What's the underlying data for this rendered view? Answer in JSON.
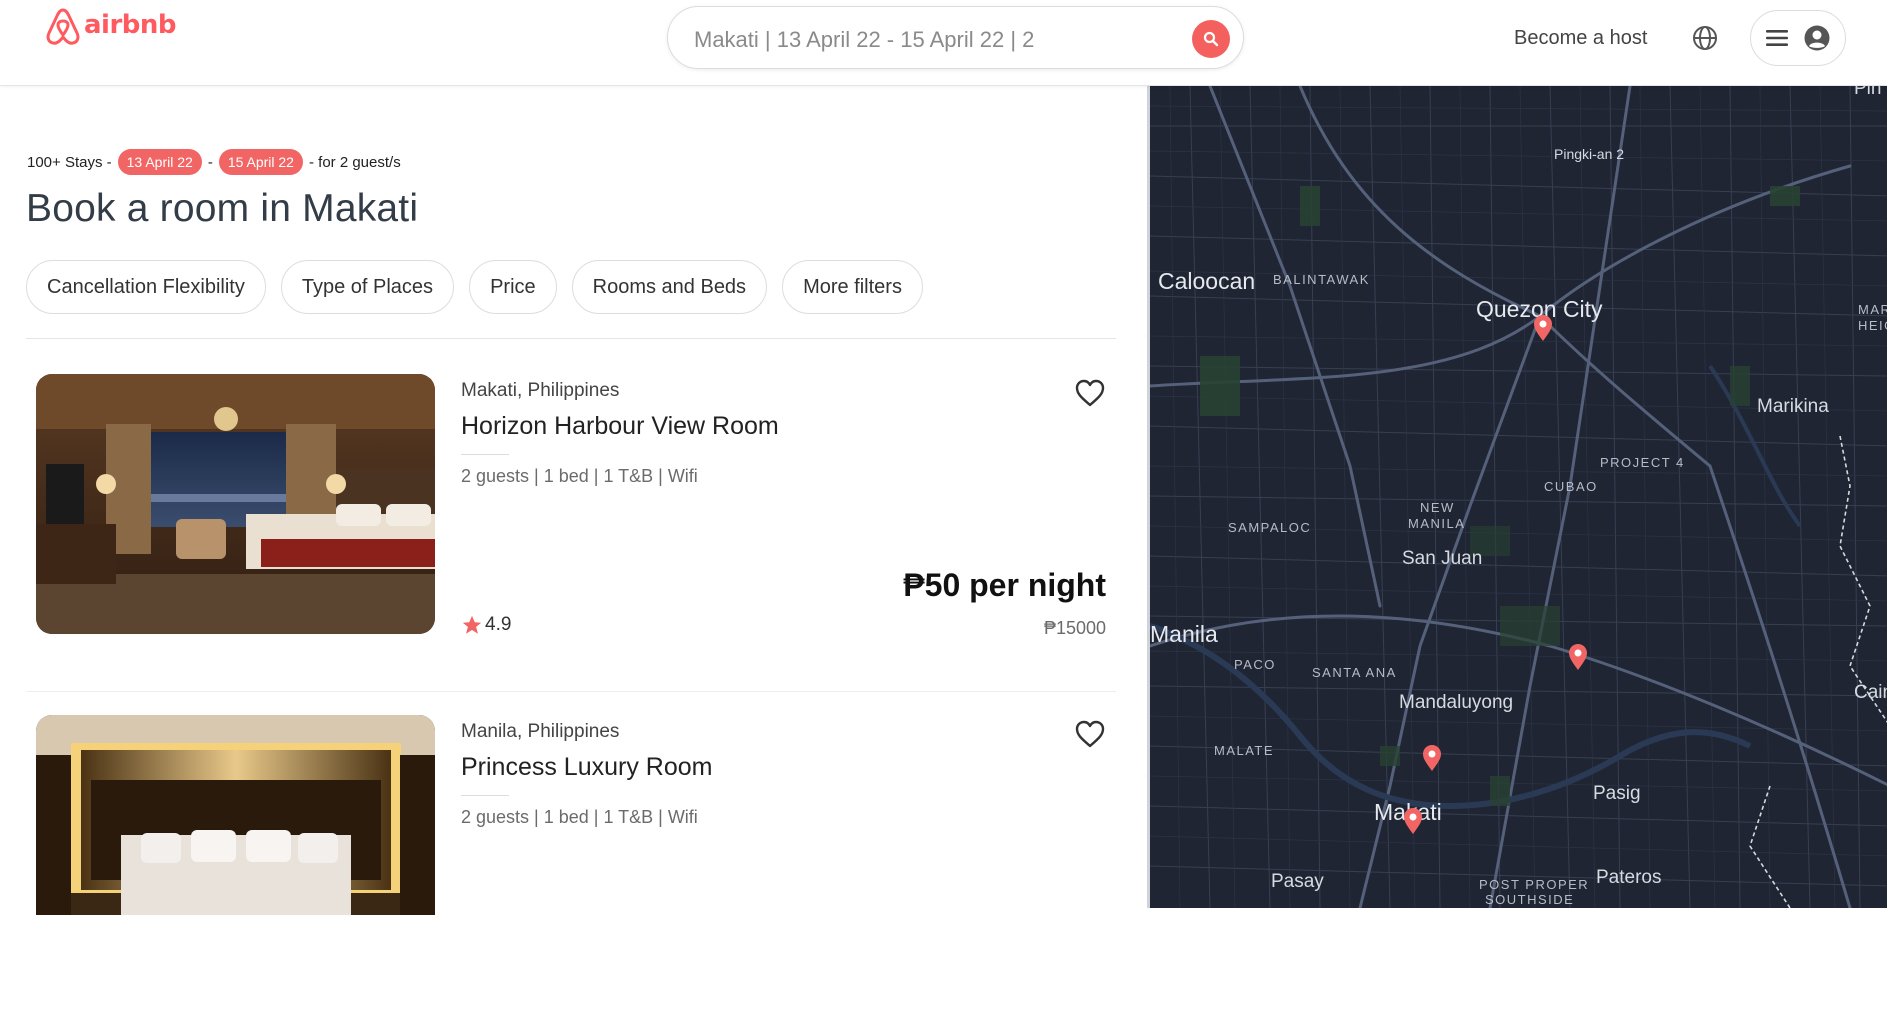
{
  "brand": {
    "name": "airbnb",
    "color": "#ff5a5f"
  },
  "header": {
    "search_text": "Makati | 13 April 22 - 15 April 22 | 2",
    "become_host": "Become a host",
    "icons": [
      "search-icon",
      "globe-icon",
      "menu-icon",
      "user-icon"
    ]
  },
  "results": {
    "count_text": "100+ Stays -",
    "check_in": "13 April 22",
    "separator": "-",
    "check_out": "15 April 22",
    "guests_text": "- for 2 guest/s",
    "title": "Book a room in Makati"
  },
  "filters": [
    "Cancellation Flexibility",
    "Type of Places",
    "Price",
    "Rooms and Beds",
    "More filters"
  ],
  "listings": [
    {
      "location": "Makati, Philippines",
      "name": "Horizon Harbour View Room",
      "amenities": "2 guests | 1 bed | 1 T&B | Wifi",
      "rating": "4.9",
      "price": "₱50 per night",
      "total": "₱15000"
    },
    {
      "location": "Manila, Philippines",
      "name": "Princess Luxury Room",
      "amenities": "2 guests | 1 bed | 1 T&B | Wifi"
    }
  ],
  "map": {
    "labels": {
      "pingki": "Pingki-an 2",
      "caloocan": "Caloocan",
      "balintawak": "BALINTAWAK",
      "quezon": "Quezon City",
      "mari": "MARI",
      "heig": "HEIG",
      "marikina": "Marikina",
      "project4": "PROJECT 4",
      "cubao": "CUBAO",
      "new": "NEW",
      "manila_district": "MANILA",
      "sampaloc": "SAMPALOC",
      "sanjuan": "San Juan",
      "manila": "Manila",
      "paco": "PACO",
      "santaana": "SANTA ANA",
      "mandaluyong": "Mandaluyong",
      "malate": "MALATE",
      "pasig": "Pasig",
      "makati": "Makati",
      "pasay": "Pasay",
      "postproper": "POST PROPER",
      "southside": "SOUTHSIDE",
      "pateros": "Pateros",
      "cain": "Cain",
      "pin": "Pin"
    },
    "accent": "#f26565"
  }
}
